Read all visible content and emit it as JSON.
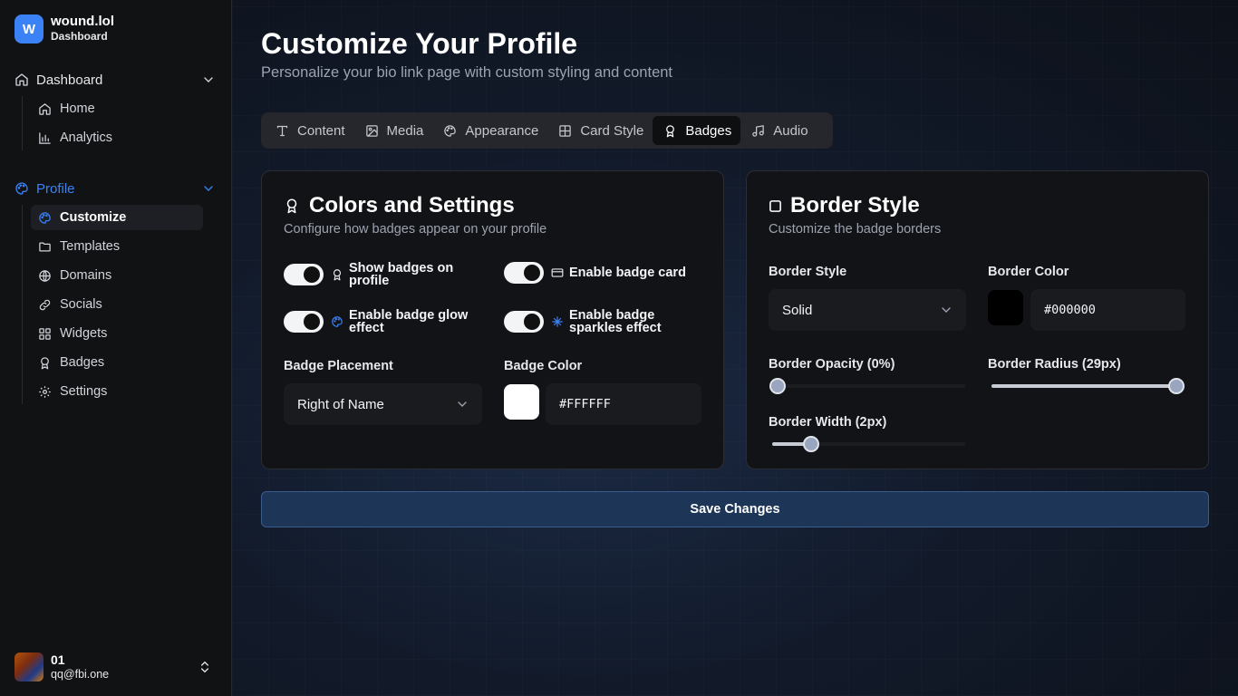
{
  "app": {
    "logo_letter": "W",
    "name": "wound.lol",
    "section": "Dashboard"
  },
  "sidebar": {
    "groups": [
      {
        "label": "Dashboard",
        "icon": "house-icon",
        "expanded": true,
        "items": [
          {
            "label": "Home",
            "icon": "house-icon"
          },
          {
            "label": "Analytics",
            "icon": "bar-chart-icon"
          }
        ]
      },
      {
        "label": "Profile",
        "icon": "palette-icon",
        "expanded": true,
        "active": true,
        "items": [
          {
            "label": "Customize",
            "icon": "palette-icon",
            "selected": true
          },
          {
            "label": "Templates",
            "icon": "folder-icon"
          },
          {
            "label": "Domains",
            "icon": "globe-icon"
          },
          {
            "label": "Socials",
            "icon": "link-icon"
          },
          {
            "label": "Widgets",
            "icon": "grid-icon"
          },
          {
            "label": "Badges",
            "icon": "award-icon"
          },
          {
            "label": "Settings",
            "icon": "gear-icon"
          }
        ]
      }
    ]
  },
  "user": {
    "name": "01",
    "email": "qq@fbi.one"
  },
  "page": {
    "title": "Customize Your Profile",
    "subtitle": "Personalize your bio link page with custom styling and content"
  },
  "tabs": [
    {
      "label": "Content",
      "icon": "text-icon"
    },
    {
      "label": "Media",
      "icon": "image-icon"
    },
    {
      "label": "Appearance",
      "icon": "palette-icon"
    },
    {
      "label": "Card Style",
      "icon": "table-icon"
    },
    {
      "label": "Badges",
      "icon": "award-icon",
      "active": true
    },
    {
      "label": "Audio",
      "icon": "music-icon"
    }
  ],
  "colors_card": {
    "title": "Colors and Settings",
    "description": "Configure how badges appear on your profile",
    "toggles": [
      {
        "label": "Show badges on profile",
        "on": true,
        "icon": "award-icon"
      },
      {
        "label": "Enable badge card",
        "on": true,
        "icon": "credit-card-icon"
      },
      {
        "label": "Enable badge glow effect",
        "on": true,
        "icon": "palette-icon"
      },
      {
        "label": "Enable badge sparkles effect",
        "on": true,
        "icon": "sparkles-icon"
      }
    ],
    "placement_label": "Badge Placement",
    "placement_value": "Right of Name",
    "color_label": "Badge Color",
    "color_value": "#FFFFFF"
  },
  "border_card": {
    "title": "Border Style",
    "description": "Customize the badge borders",
    "style_label": "Border Style",
    "style_value": "Solid",
    "color_label": "Border Color",
    "color_value": "#000000",
    "opacity_label": "Border Opacity (0%)",
    "opacity_fraction": 0.0,
    "radius_label": "Border Radius (29px)",
    "radius_fraction": 0.97,
    "width_label": "Border Width (2px)",
    "width_fraction": 0.2
  },
  "save_label": "Save Changes",
  "colors": {
    "accent": "#3b82f6",
    "save_bg": "#1d3557",
    "panel": "#121317"
  }
}
